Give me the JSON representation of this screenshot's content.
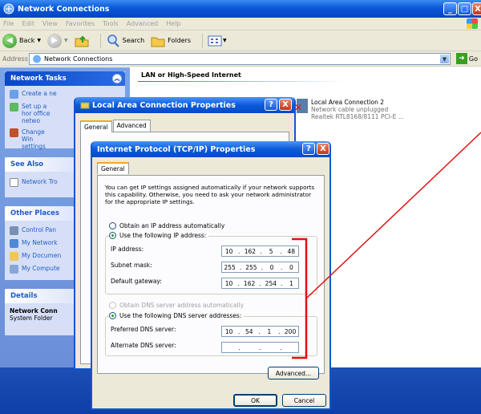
{
  "window": {
    "title": "Network Connections",
    "menu": [
      "File",
      "Edit",
      "View",
      "Favorites",
      "Tools",
      "Advanced",
      "Help"
    ],
    "toolbar": {
      "back": "Back",
      "search": "Search",
      "folders": "Folders"
    },
    "address_label": "Address",
    "address_value": "Network Connections",
    "go_label": "Go"
  },
  "taskpane": {
    "network_tasks": {
      "title": "Network Tasks",
      "items": [
        "Create a ne",
        "Set up a hor office netwo",
        "Change Win settings"
      ]
    },
    "see_also": {
      "title": "See Also",
      "items": [
        "Network Tro"
      ]
    },
    "other_places": {
      "title": "Other Places",
      "items": [
        "Control Pan",
        "My Network",
        "My Documen",
        "My Compute"
      ]
    },
    "details": {
      "title": "Details",
      "name": "Network Conn",
      "type": "System Folder"
    }
  },
  "content": {
    "group_header": "LAN or High-Speed Internet",
    "connection2": {
      "name": "Local Area Connection 2",
      "status": "Network cable unplugged",
      "device": "Realtek RTL8168/8111 PCI-E ..."
    }
  },
  "lacp_dialog": {
    "title": "Local Area Connection Properties",
    "tabs": [
      "General",
      "Advanced"
    ],
    "help": "?",
    "close": "X"
  },
  "tcpip_dialog": {
    "title": "Internet Protocol (TCP/IP) Properties",
    "help": "?",
    "close": "X",
    "tab": "General",
    "intro": "You can get IP settings assigned automatically if your network supports this capability. Otherwise, you need to ask your network administrator for the appropriate IP settings.",
    "ip_auto": "Obtain an IP address automatically",
    "ip_manual": "Use the following IP address:",
    "ip_label": "IP address:",
    "ip_value": [
      "10",
      "162",
      "5",
      "48"
    ],
    "mask_label": "Subnet mask:",
    "mask_value": [
      "255",
      "255",
      "0",
      "0"
    ],
    "gw_label": "Default gateway:",
    "gw_value": [
      "10",
      "162",
      "254",
      "1"
    ],
    "dns_auto": "Obtain DNS server address automatically",
    "dns_manual": "Use the following DNS server addresses:",
    "pdns_label": "Preferred DNS server:",
    "pdns_value": [
      "10",
      "54",
      "1",
      "200"
    ],
    "adns_label": "Alternate DNS server:",
    "adns_value": [
      "",
      "",
      "",
      ""
    ],
    "advanced_button": "Advanced...",
    "ok_button": "OK",
    "cancel_button": "Cancel"
  },
  "colors": {
    "accent": "#0a58d8",
    "annotation": "#e01010"
  }
}
